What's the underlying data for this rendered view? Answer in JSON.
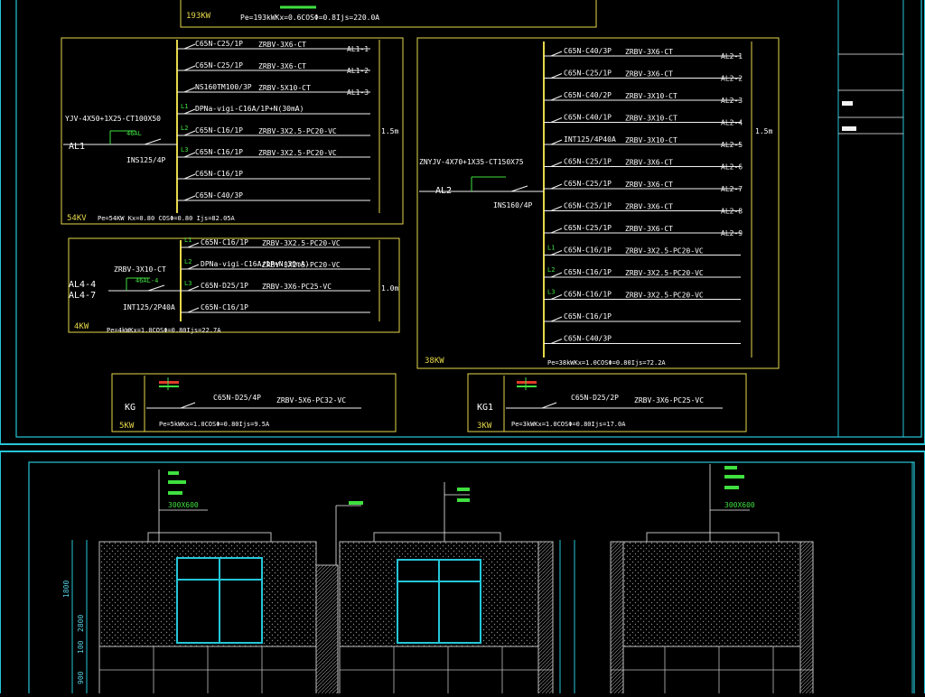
{
  "colors": {
    "background": "#000000",
    "frame": "#25c6d8",
    "panel": "#e6d84a",
    "bus": "#e6d84a",
    "circuit": "#f2f2f2",
    "green": "#3fe03f",
    "cyan_text": "#58d6e6",
    "red": "#e23a2a",
    "window": "#25c6d8"
  },
  "top": {
    "label_193": "193KW",
    "formula_193": "Pe=193kWKx=0.6COSΦ=0.8Ijs=220.0A"
  },
  "al1": {
    "cable": "YJV-4X50+1X25-CT100X50",
    "name": "AL1",
    "main_breaker": "INS125/4P",
    "small_label": "46AL",
    "power": "54KV",
    "formula": "Pe=54KW Kx=0.80 COSΦ=0.80 Ijs=82.05A",
    "right_note": "1.5m",
    "circuits": [
      {
        "breaker": "C65N-C25/1P",
        "cable": "ZRBV-3X6-CT",
        "id": "AL1-1"
      },
      {
        "breaker": "C65N-C25/1P",
        "cable": "ZRBV-3X6-CT",
        "id": "AL1-2"
      },
      {
        "breaker": "NS160TM100/3P",
        "cable": "ZRBV-5X10-CT",
        "id": "AL1-3"
      },
      {
        "breaker": "DPNa-vigi-C16A/1P+N(30mA)",
        "cable": "",
        "id": "",
        "tag": "L1"
      },
      {
        "breaker": "C65N-C16/1P",
        "cable": "ZRBV-3X2.5-PC20-VC",
        "id": "",
        "tag": "L2"
      },
      {
        "breaker": "C65N-C16/1P",
        "cable": "ZRBV-3X2.5-PC20-VC",
        "id": "",
        "tag": "L3"
      },
      {
        "breaker": "C65N-C16/1P",
        "cable": "",
        "id": ""
      },
      {
        "breaker": "C65N-C40/3P",
        "cable": "",
        "id": ""
      }
    ]
  },
  "al4": {
    "name1": "AL4-4",
    "name2": "AL4-7",
    "small_label": "46AL-4",
    "cable": "ZRBV-3X10-CT",
    "main_breaker": "INT125/2P40A",
    "power": "4KW",
    "formula": "Pe=4kWKx=1.0COSΦ=0.80Ijs=22.7A",
    "right_note": "1.0m",
    "circuits": [
      {
        "breaker": "C65N-C16/1P",
        "cable": "ZRBV-3X2.5-PC20-VC",
        "tag": "L1"
      },
      {
        "breaker": "DPNa-vigi-C16A/1P+N(30mA)",
        "cable": "ZRBV-3X2.5-PC20-VC",
        "tag": "L2"
      },
      {
        "breaker": "C65N-D25/1P",
        "cable": "ZRBV-3X6-PC25-VC",
        "tag": "L3"
      },
      {
        "breaker": "C65N-C16/1P",
        "cable": "",
        "tag": ""
      }
    ]
  },
  "al2": {
    "cable": "ZNYJV-4X70+1X35-CT150X75",
    "name": "AL2",
    "main_breaker": "INS160/4P",
    "power": "38KW",
    "formula": "Pe=38kWKx=1.0COSΦ=0.80Ijs=72.2A",
    "right_note": "1.5m",
    "circuits": [
      {
        "breaker": "C65N-C40/3P",
        "cable": "ZRBV-3X6-CT",
        "id": "AL2-1"
      },
      {
        "breaker": "C65N-C25/1P",
        "cable": "ZRBV-3X6-CT",
        "id": "AL2-2"
      },
      {
        "breaker": "C65N-C40/2P",
        "cable": "ZRBV-3X10-CT",
        "id": "AL2-3"
      },
      {
        "breaker": "C65N-C40/1P",
        "cable": "ZRBV-3X10-CT",
        "id": "AL2-4"
      },
      {
        "breaker": "INT125/4P40A",
        "cable": "ZRBV-3X10-CT",
        "id": "AL2-5"
      },
      {
        "breaker": "C65N-C25/1P",
        "cable": "ZRBV-3X6-CT",
        "id": "AL2-6"
      },
      {
        "breaker": "C65N-C25/1P",
        "cable": "ZRBV-3X6-CT",
        "id": "AL2-7"
      },
      {
        "breaker": "C65N-C25/1P",
        "cable": "ZRBV-3X6-CT",
        "id": "AL2-8"
      },
      {
        "breaker": "C65N-C25/1P",
        "cable": "ZRBV-3X6-CT",
        "id": "AL2-9"
      },
      {
        "breaker": "C65N-C16/1P",
        "cable": "ZRBV-3X2.5-PC20-VC",
        "id": "",
        "tag": "L1"
      },
      {
        "breaker": "C65N-C16/1P",
        "cable": "ZRBV-3X2.5-PC20-VC",
        "id": "",
        "tag": "L2"
      },
      {
        "breaker": "C65N-C16/1P",
        "cable": "ZRBV-3X2.5-PC20-VC",
        "id": "",
        "tag": "L3"
      },
      {
        "breaker": "C65N-C16/1P",
        "cable": "",
        "id": ""
      },
      {
        "breaker": "C65N-C40/3P",
        "cable": "",
        "id": ""
      }
    ]
  },
  "kg": {
    "name": "KG",
    "breaker": "C65N-D25/4P",
    "cable": "ZRBV-5X6-PC32-VC",
    "power": "5KW",
    "formula": "Pe=5kWKx=1.0COSΦ=0.80Ijs=9.5A"
  },
  "kg1": {
    "name": "KG1",
    "breaker": "C65N-D25/2P",
    "cable": "ZRBV-3X6-PC25-VC",
    "power": "3KW",
    "formula": "Pe=3kWKx=1.0COSΦ=0.80Ijs=17.0A"
  },
  "elevation": {
    "dim_1800": "1800",
    "dim_2800": "2800",
    "dim_100": "100",
    "dim_900": "900",
    "tile_label_left": "300X600",
    "tile_label_right": "300X600"
  }
}
